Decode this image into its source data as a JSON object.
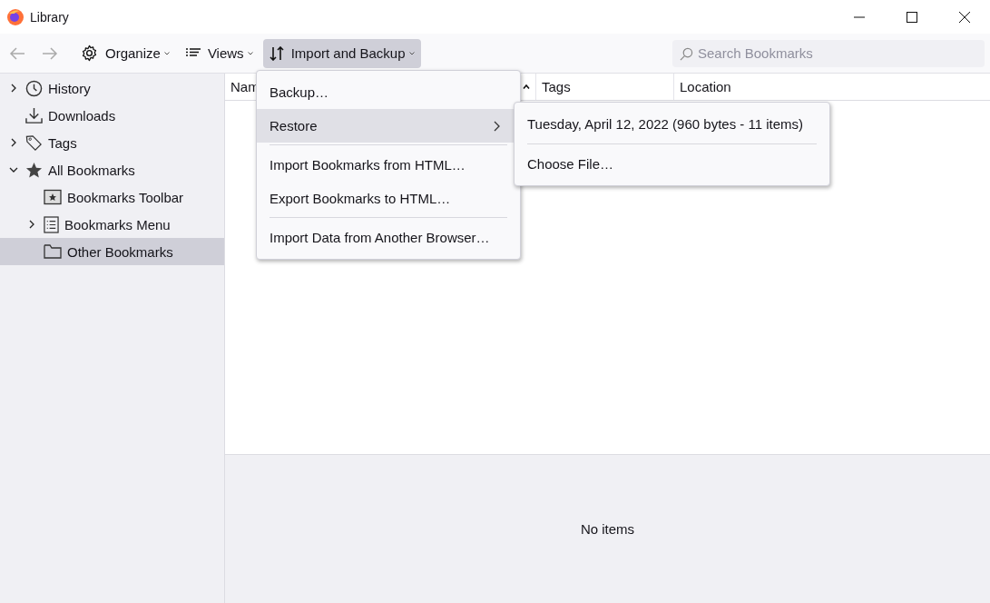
{
  "window": {
    "title": "Library"
  },
  "toolbar": {
    "back_disabled": true,
    "forward_disabled": true,
    "buttons": [
      {
        "kind": "organize",
        "label": "Organize",
        "selected": false
      },
      {
        "kind": "views",
        "label": "Views",
        "selected": false
      },
      {
        "kind": "import",
        "label": "Import and Backup",
        "selected": true
      }
    ],
    "search": {
      "placeholder": "Search Bookmarks"
    }
  },
  "sidebar": {
    "items": [
      {
        "kind": "history",
        "label": "History",
        "expanded": false,
        "selected": false
      },
      {
        "kind": "downloads",
        "label": "Downloads",
        "selected": false
      },
      {
        "kind": "tags",
        "label": "Tags",
        "expanded": false,
        "selected": false
      },
      {
        "kind": "star",
        "label": "All Bookmarks",
        "expanded": true,
        "selected": false,
        "children": [
          {
            "kind": "toolbar",
            "label": "Bookmarks Toolbar",
            "selected": false
          },
          {
            "kind": "menu",
            "label": "Bookmarks Menu",
            "expanded": false,
            "selected": false
          },
          {
            "kind": "folder",
            "label": "Other Bookmarks",
            "selected": true
          }
        ]
      }
    ]
  },
  "table": {
    "columns": [
      {
        "label": "Nam",
        "sorted": true
      },
      {
        "label": "Tags",
        "sorted": false
      },
      {
        "label": "Location",
        "sorted": false
      }
    ]
  },
  "details": {
    "text": "No items"
  },
  "menu": {
    "items": [
      {
        "kind": "item",
        "label": "Backup…",
        "selected": false
      },
      {
        "kind": "submenu",
        "label": "Restore",
        "selected": true
      },
      {
        "kind": "separator"
      },
      {
        "kind": "item",
        "label": "Import Bookmarks from HTML…",
        "selected": false
      },
      {
        "kind": "item",
        "label": "Export Bookmarks to HTML…",
        "selected": false
      },
      {
        "kind": "separator"
      },
      {
        "kind": "item",
        "label": "Import Data from Another Browser…",
        "selected": false
      }
    ]
  },
  "submenu": {
    "items": [
      {
        "kind": "item",
        "label": "Tuesday, April 12, 2022 (960 bytes - 11 items)",
        "selected": false
      },
      {
        "kind": "separator"
      },
      {
        "kind": "item",
        "label": "Choose File…",
        "selected": false
      }
    ]
  }
}
